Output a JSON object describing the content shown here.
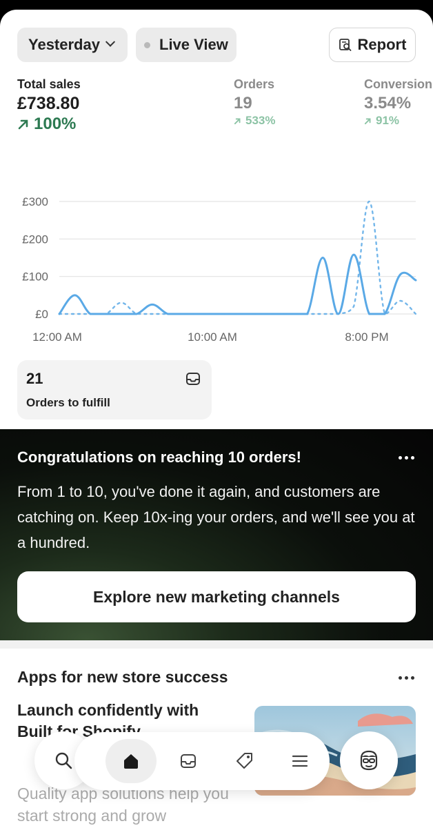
{
  "controls": {
    "date_label": "Yesterday",
    "live_label": "Live View",
    "report_label": "Report"
  },
  "metrics": [
    {
      "label": "Total sales",
      "value": "£738.80",
      "change": "100%"
    },
    {
      "label": "Orders",
      "value": "19",
      "change": "533%"
    },
    {
      "label": "Conversion",
      "value": "3.54%",
      "change": "91%"
    }
  ],
  "chart_data": {
    "type": "line",
    "x_labels": [
      "12:00 AM",
      "10:00 AM",
      "8:00 PM"
    ],
    "y_labels": [
      "£300",
      "£200",
      "£100",
      "£0"
    ],
    "ylim": [
      0,
      300
    ],
    "series": [
      {
        "style": "solid",
        "x": [
          0,
          1,
          2,
          3,
          4,
          5,
          6,
          7,
          8,
          9,
          10,
          11,
          12,
          13,
          14,
          15,
          16,
          17,
          18,
          19,
          20,
          21,
          22,
          23
        ],
        "values": [
          0,
          50,
          0,
          0,
          0,
          0,
          25,
          0,
          0,
          0,
          0,
          0,
          0,
          0,
          0,
          0,
          0,
          150,
          0,
          158,
          0,
          0,
          105,
          90
        ]
      },
      {
        "style": "dotted",
        "x": [
          0,
          1,
          2,
          3,
          4,
          5,
          6,
          7,
          8,
          9,
          10,
          11,
          12,
          13,
          14,
          15,
          16,
          17,
          18,
          19,
          20,
          21,
          22,
          23
        ],
        "values": [
          0,
          0,
          0,
          0,
          30,
          0,
          0,
          0,
          0,
          0,
          0,
          0,
          0,
          0,
          0,
          0,
          0,
          0,
          0,
          20,
          300,
          0,
          35,
          0
        ]
      }
    ],
    "grid": true,
    "colors": {
      "line": "#5aa9e6",
      "grid": "#e3e3e3"
    }
  },
  "fulfill": {
    "count": "21",
    "label": "Orders to fulfill"
  },
  "congrats": {
    "title": "Congratulations on reaching 10 orders!",
    "body": "From 1 to 10, you've done it again, and customers are catching on. Keep 10x-ing your orders, and we'll see you at a hundred.",
    "cta": "Explore new marketing channels"
  },
  "apps": {
    "title": "Apps for new store success",
    "card_title": "Launch confidently with Built for Shopify",
    "card_desc": "Quality app solutions help you start strong and grow"
  },
  "nav": {
    "icons": [
      "search-icon",
      "home-icon",
      "inbox-icon",
      "tag-icon",
      "menu-icon",
      "avatar-icon"
    ]
  },
  "colors": {
    "accent_green": "#2d7a52",
    "light_green": "#8cc3a5",
    "chart_blue": "#5aa9e6"
  }
}
